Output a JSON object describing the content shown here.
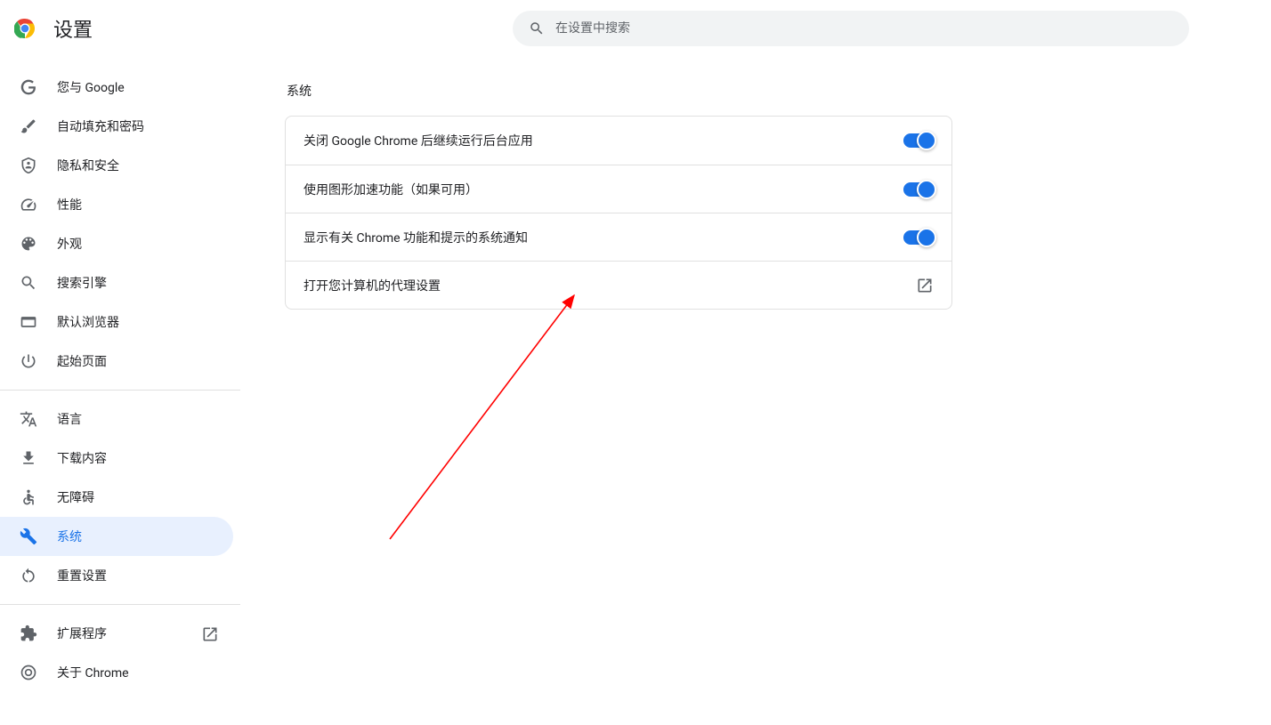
{
  "header": {
    "title": "设置",
    "search_placeholder": "在设置中搜索"
  },
  "sidebar": {
    "groups": [
      [
        {
          "id": "you-and-google",
          "icon": "google",
          "label": "您与 Google"
        },
        {
          "id": "autofill",
          "icon": "key",
          "label": "自动填充和密码"
        },
        {
          "id": "privacy",
          "icon": "shield",
          "label": "隐私和安全"
        },
        {
          "id": "performance",
          "icon": "speed",
          "label": "性能"
        },
        {
          "id": "appearance",
          "icon": "palette",
          "label": "外观"
        },
        {
          "id": "search-engine",
          "icon": "search",
          "label": "搜索引擎"
        },
        {
          "id": "default-browser",
          "icon": "browser",
          "label": "默认浏览器"
        },
        {
          "id": "on-startup",
          "icon": "power",
          "label": "起始页面"
        }
      ],
      [
        {
          "id": "languages",
          "icon": "translate",
          "label": "语言"
        },
        {
          "id": "downloads",
          "icon": "download",
          "label": "下载内容"
        },
        {
          "id": "accessibility",
          "icon": "accessibility",
          "label": "无障碍"
        },
        {
          "id": "system",
          "icon": "wrench",
          "label": "系统",
          "active": true
        },
        {
          "id": "reset",
          "icon": "reset",
          "label": "重置设置"
        }
      ],
      [
        {
          "id": "extensions",
          "icon": "extension",
          "label": "扩展程序",
          "external": true
        },
        {
          "id": "about",
          "icon": "chrome-outline",
          "label": "关于 Chrome"
        }
      ]
    ]
  },
  "main": {
    "section_title": "系统",
    "rows": [
      {
        "id": "background-apps",
        "label": "关闭 Google Chrome 后继续运行后台应用",
        "type": "toggle",
        "on": true
      },
      {
        "id": "hw-accel",
        "label": "使用图形加速功能（如果可用）",
        "type": "toggle",
        "on": true
      },
      {
        "id": "chrome-notifications",
        "label": "显示有关 Chrome 功能和提示的系统通知",
        "type": "toggle",
        "on": true
      },
      {
        "id": "proxy",
        "label": "打开您计算机的代理设置",
        "type": "link"
      }
    ]
  },
  "colors": {
    "accent": "#1a73e8",
    "search_bg": "#f1f3f4",
    "border": "#e0e0e0",
    "icon": "#5f6368"
  },
  "annotation": {
    "type": "arrow",
    "color": "#ff0000"
  }
}
